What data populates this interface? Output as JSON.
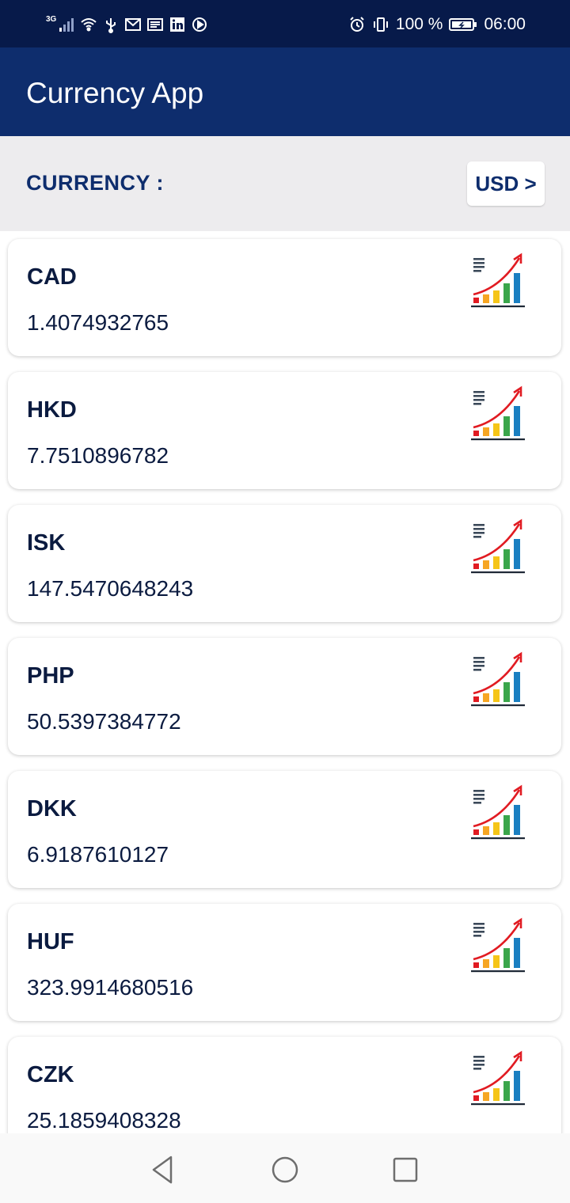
{
  "status_bar": {
    "network_type": "3G",
    "battery_percent": "100 %",
    "time": "06:00",
    "icons_left": [
      "signal-icon",
      "wifi-icon",
      "usb-icon",
      "gmail-icon",
      "news-icon",
      "linkedin-icon",
      "play-icon"
    ],
    "icons_right": [
      "alarm-icon",
      "vibrate-icon",
      "battery-icon"
    ]
  },
  "app_bar": {
    "title": "Currency App"
  },
  "selector": {
    "label": "CURRENCY :",
    "base_currency": "USD >"
  },
  "rates": [
    {
      "code": "CAD",
      "value": "1.4074932765"
    },
    {
      "code": "HKD",
      "value": "7.7510896782"
    },
    {
      "code": "ISK",
      "value": "147.5470648243"
    },
    {
      "code": "PHP",
      "value": "50.5397384772"
    },
    {
      "code": "DKK",
      "value": "6.9187610127"
    },
    {
      "code": "HUF",
      "value": "323.9914680516"
    },
    {
      "code": "CZK",
      "value": "25.1859408328"
    }
  ],
  "rate_icon": "chart-growth-icon",
  "nav_bar": {
    "icons": [
      "back-icon",
      "home-icon",
      "recents-icon"
    ]
  },
  "colors": {
    "status_bar": "#071a4a",
    "app_bar": "#0e2d6d",
    "selector_bg": "#edecee",
    "text_dark": "#0b1b40"
  }
}
